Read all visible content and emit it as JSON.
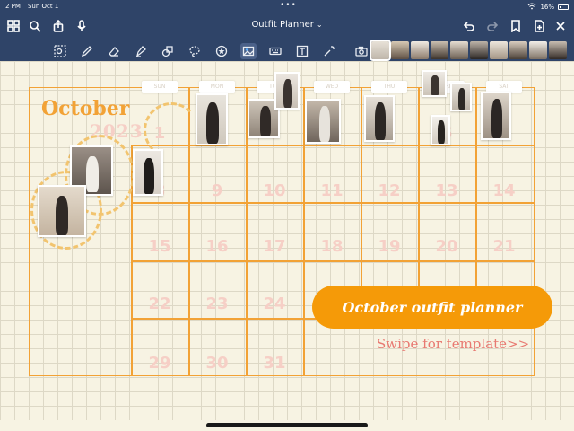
{
  "status": {
    "time": "2 PM",
    "date": "Sun Oct 1",
    "battery": "16%"
  },
  "nav": {
    "title": "Outfit Planner"
  },
  "calendar": {
    "month": "October",
    "year": "2023",
    "day_tabs": [
      "SUN",
      "MON",
      "TUE",
      "WED",
      "THU",
      "FRI",
      "SAT"
    ],
    "dates": [
      "1",
      "2",
      "3",
      "4",
      "5",
      "6",
      "7",
      "8",
      "9",
      "10",
      "11",
      "12",
      "13",
      "14",
      "15",
      "16",
      "17",
      "18",
      "19",
      "20",
      "21",
      "22",
      "23",
      "24",
      "25",
      "26",
      "27",
      "28",
      "29",
      "30",
      "31"
    ]
  },
  "banner": {
    "title": "October outfit planner",
    "swipe": "Swipe for template>>"
  },
  "colors": {
    "accent": "#f59a08",
    "grid": "#f2a236",
    "toolbar": "#2f4468",
    "date_numbers": "#f6cfc6"
  },
  "toolbar_icons": [
    "lasso-select-icon",
    "pen-icon",
    "eraser-icon",
    "highlighter-icon",
    "shapes-icon",
    "lasso-icon",
    "sticker-icon",
    "image-icon",
    "keyboard-icon",
    "text-icon",
    "laser-pointer-icon",
    "camera-icon"
  ]
}
